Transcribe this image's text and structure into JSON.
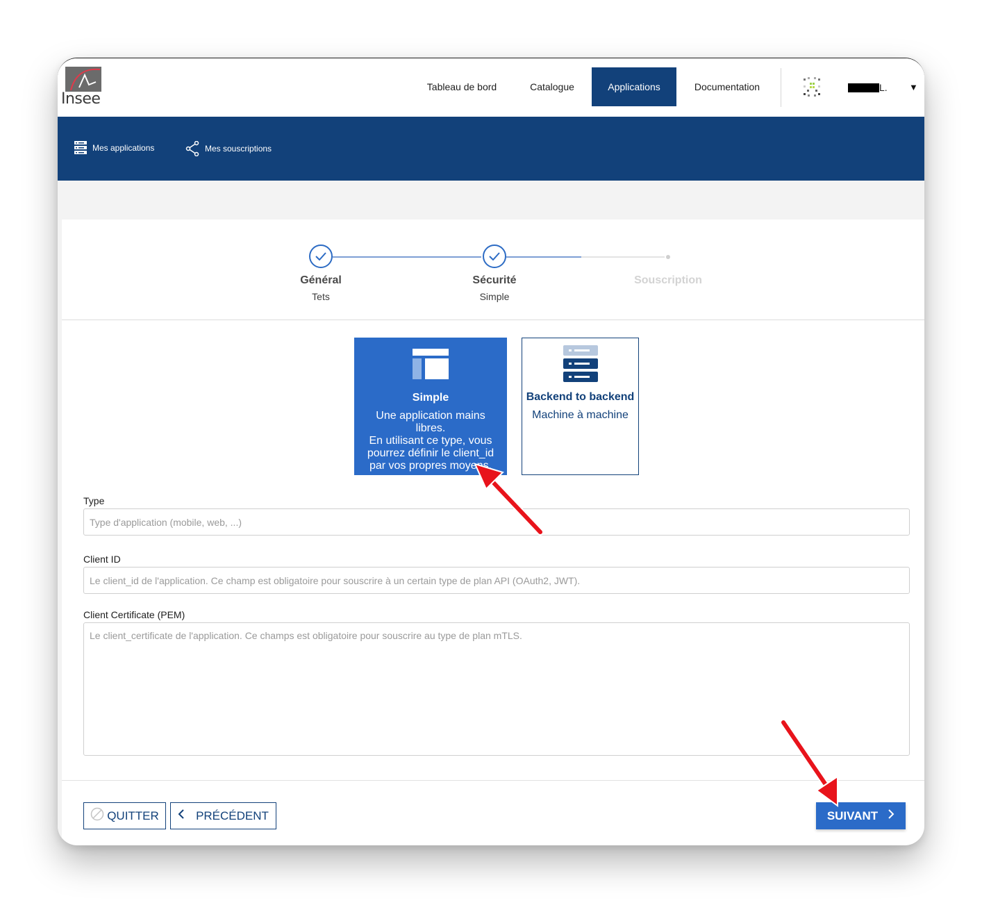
{
  "header": {
    "logo_text": "Insee",
    "nav": [
      {
        "label": "Tableau de bord"
      },
      {
        "label": "Catalogue"
      },
      {
        "label": "Applications",
        "active": true
      },
      {
        "label": "Documentation"
      }
    ],
    "username_suffix": "L.",
    "dropdown_icon": "caret-down-icon"
  },
  "subnav": {
    "items": [
      {
        "label": "Mes applications",
        "icon": "server-list-icon"
      },
      {
        "label": "Mes souscriptions",
        "icon": "share-icon"
      }
    ]
  },
  "stepper": {
    "steps": [
      {
        "title": "Général",
        "subtitle": "Tets",
        "state": "done"
      },
      {
        "title": "Sécurité",
        "subtitle": "Simple",
        "state": "done"
      },
      {
        "title": "Souscription",
        "subtitle": "",
        "state": "pending"
      }
    ]
  },
  "security_types": [
    {
      "title": "Simple",
      "description": [
        "Une application mains",
        "libres.",
        "En utilisant ce type, vous",
        "pourrez définir le client_id",
        "par vos propres moyens."
      ],
      "selected": true,
      "icon": "layout-icon"
    },
    {
      "title": "Backend to backend",
      "description": [
        "Machine à machine"
      ],
      "selected": false,
      "icon": "server-icon"
    }
  ],
  "form": {
    "type": {
      "label": "Type",
      "value": "",
      "placeholder": "Type d'application (mobile, web, ...)"
    },
    "client_id": {
      "label": "Client ID",
      "value": "",
      "placeholder": "Le client_id de l'application. Ce champ est obligatoire pour souscrire à un certain type de plan API (OAuth2, JWT)."
    },
    "client_certificate": {
      "label": "Client Certificate (PEM)",
      "value": "",
      "placeholder": "Le client_certificate de l'application. Ce champs est obligatoire pour souscrire au type de plan mTLS."
    }
  },
  "footer": {
    "quit_label": "QUITTER",
    "previous_label": "PRÉCÉDENT",
    "next_label": "SUIVANT"
  },
  "colors": {
    "primary_dark": "#12417a",
    "primary": "#2b6bc8",
    "annotation_arrow": "#e8131b"
  }
}
